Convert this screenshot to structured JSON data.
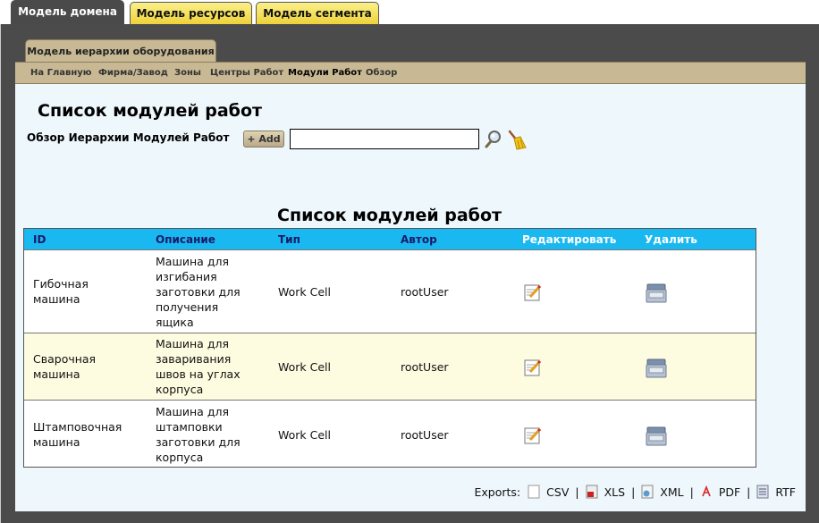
{
  "top_tabs": [
    {
      "label": "Модель домена",
      "active": true
    },
    {
      "label": "Модель ресурсов",
      "active": false
    },
    {
      "label": "Модель сегмента",
      "active": false
    }
  ],
  "sub_tab": {
    "label": "Модель иерархии оборудования"
  },
  "nav": {
    "items": [
      {
        "label": "На Главную"
      },
      {
        "label": "Фирма/Завод"
      },
      {
        "label": "Зоны"
      },
      {
        "label": "Центры Работ"
      },
      {
        "label": "Модули Работ",
        "current": true
      },
      {
        "label": "Обзор"
      }
    ]
  },
  "page": {
    "title": "Список модулей работ"
  },
  "search": {
    "label": "Обзор Иерархии Модулей Работ",
    "add_label": "+ Add",
    "value": "",
    "search_icon": "magnifier-icon",
    "clear_icon": "broom-icon"
  },
  "table": {
    "title": "Список модулей работ",
    "header_color": "#1ab8f0",
    "columns": {
      "id": "ID",
      "description": "Описание",
      "type": "Тип",
      "author": "Автор",
      "edit": "Редактировать",
      "delete": "Удалить"
    },
    "rows": [
      {
        "id_lines": [
          "Гибочная",
          "машина"
        ],
        "description_lines": [
          "Машина для",
          "изгибания",
          "заготовки для",
          "получения",
          "ящика"
        ],
        "type": "Work Cell",
        "author": "rootUser"
      },
      {
        "id_lines": [
          "Сварочная",
          "машина"
        ],
        "description_lines": [
          "Машина для",
          "заваривания",
          "швов на углах",
          "корпуса"
        ],
        "type": "Work Cell",
        "author": "rootUser"
      },
      {
        "id_lines": [
          "Штамповочная",
          "машина"
        ],
        "description_lines": [
          "Машина для",
          "штамповки",
          "заготовки для",
          "корпуса"
        ],
        "type": "Work Cell",
        "author": "rootUser"
      }
    ]
  },
  "exports": {
    "label": "Exports:",
    "formats": [
      "CSV",
      "XLS",
      "XML",
      "PDF",
      "RTF"
    ]
  }
}
